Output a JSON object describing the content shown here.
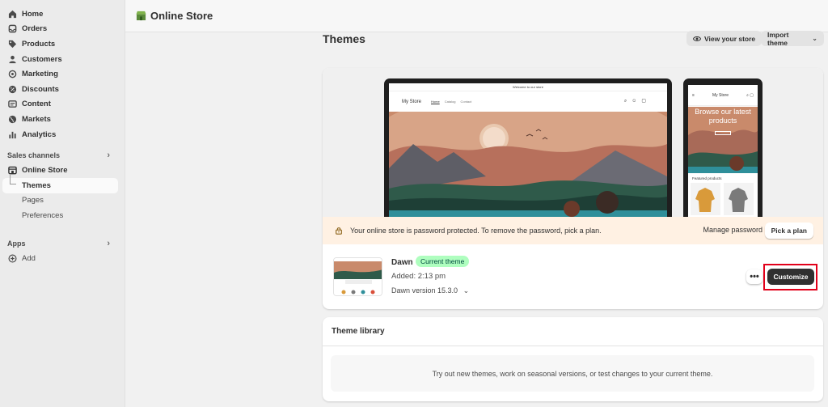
{
  "sidebar": {
    "items": [
      {
        "label": "Home",
        "icon": "home-icon"
      },
      {
        "label": "Orders",
        "icon": "orders-icon"
      },
      {
        "label": "Products",
        "icon": "tag-icon"
      },
      {
        "label": "Customers",
        "icon": "person-icon"
      },
      {
        "label": "Marketing",
        "icon": "target-icon"
      },
      {
        "label": "Discounts",
        "icon": "discount-icon"
      },
      {
        "label": "Content",
        "icon": "content-icon"
      },
      {
        "label": "Markets",
        "icon": "globe-icon"
      },
      {
        "label": "Analytics",
        "icon": "chart-icon"
      }
    ],
    "sales_channels": {
      "label": "Sales channels",
      "online_store": "Online Store",
      "themes": "Themes",
      "pages": "Pages",
      "preferences": "Preferences"
    },
    "apps": {
      "label": "Apps",
      "add": "Add"
    }
  },
  "topbar": {
    "title": "Online Store"
  },
  "main": {
    "title": "Themes",
    "view_store_label": "View your store",
    "import_theme_label": "Import theme"
  },
  "preview": {
    "desktop": {
      "announcement": "Welcome to our store",
      "store_name": "My Store",
      "nav_links": [
        "Home",
        "Catalog",
        "Contact"
      ]
    },
    "phone": {
      "store_name": "My Store",
      "hero_text": "Browse our latest products",
      "featured_label": "Featured products"
    }
  },
  "banner": {
    "message": "Your online store is password protected. To remove the password, pick a plan.",
    "manage_label": "Manage password",
    "pick_label": "Pick a plan"
  },
  "current_theme": {
    "name": "Dawn",
    "badge": "Current theme",
    "added": "Added: 2:13 pm",
    "version": "Dawn version 15.3.0",
    "more_label": "•••",
    "customize_label": "Customize"
  },
  "library": {
    "title": "Theme library",
    "empty_text": "Try out new themes, work on seasonal versions, or test changes to your current theme."
  },
  "colors": {
    "accent_dark": "#303030",
    "badge_bg": "#affebf",
    "banner_bg": "#fff1e3",
    "highlight": "#e2001a"
  }
}
